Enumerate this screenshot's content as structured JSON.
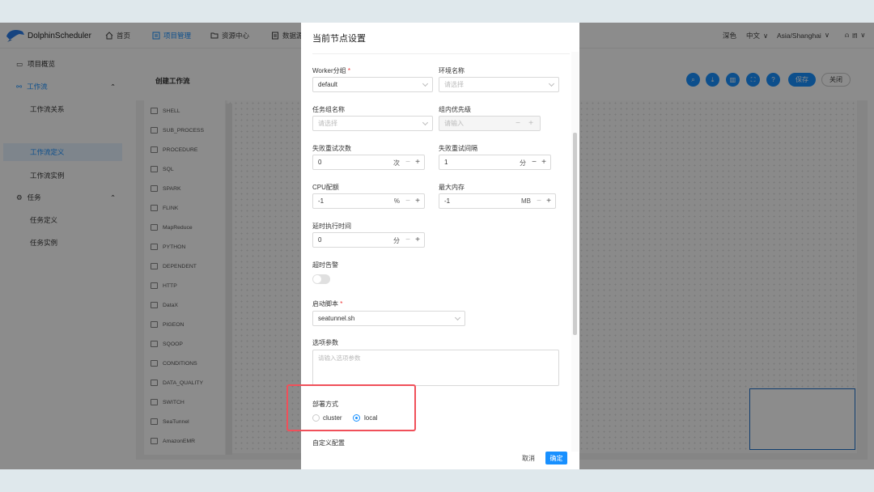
{
  "header": {
    "brand": "DolphinScheduler",
    "nav": [
      {
        "label": "首页",
        "icon": "home-icon"
      },
      {
        "label": "项目管理",
        "icon": "project-icon"
      },
      {
        "label": "资源中心",
        "icon": "folder-icon"
      },
      {
        "label": "数据源",
        "icon": "datasource-icon"
      }
    ],
    "right": {
      "theme": "深色",
      "lang": "中文",
      "timezone": "Asia/Shanghai",
      "user": "lfl"
    }
  },
  "sidebar": {
    "items": [
      {
        "label": "项目概览",
        "icon": "overview-icon"
      },
      {
        "label": "工作流",
        "icon": "workflow-icon"
      },
      {
        "label": "工作流关系"
      },
      {
        "label": "工作流定义"
      },
      {
        "label": "工作流实例"
      },
      {
        "label": "任务",
        "icon": "task-icon"
      },
      {
        "label": "任务定义"
      },
      {
        "label": "任务实例"
      }
    ]
  },
  "canvas": {
    "title": "创建工作流",
    "save": "保存",
    "close": "关闭",
    "icons": [
      "search-icon",
      "download-icon",
      "delete-icon",
      "fullscreen-icon",
      "settings-icon",
      "format-icon"
    ]
  },
  "tools": [
    "SHELL",
    "SUB_PROCESS",
    "PROCEDURE",
    "SQL",
    "SPARK",
    "FLINK",
    "MapReduce",
    "PYTHON",
    "DEPENDENT",
    "HTTP",
    "DataX",
    "PIGEON",
    "SQOOP",
    "CONDITIONS",
    "DATA_QUALITY",
    "SWITCH",
    "SeaTunnel",
    "AmazonEMR"
  ],
  "modal": {
    "title": "当前节点设置",
    "worker_group": {
      "label": "Worker分组",
      "required": "*",
      "value": "default"
    },
    "env_name": {
      "label": "环境名称",
      "placeholder": "请选择"
    },
    "task_group_name": {
      "label": "任务组名称",
      "placeholder": "请选择"
    },
    "group_priority": {
      "label": "组内优先级",
      "placeholder": "请输入"
    },
    "fail_retry_times": {
      "label": "失败重试次数",
      "value": "0",
      "unit": "次"
    },
    "fail_retry_interval": {
      "label": "失败重试间隔",
      "value": "1",
      "unit": "分"
    },
    "cpu_quota": {
      "label": "CPU配额",
      "value": "-1",
      "unit": "%"
    },
    "max_memory": {
      "label": "最大内存",
      "value": "-1",
      "unit": "MB"
    },
    "delay_time": {
      "label": "延时执行时间",
      "value": "0",
      "unit": "分"
    },
    "timeout_alarm": {
      "label": "超时告警",
      "on": false
    },
    "startup_script": {
      "label": "启动脚本",
      "required": "*",
      "value": "seatunnel.sh"
    },
    "option_params": {
      "label": "选项参数",
      "placeholder": "请输入选项参数"
    },
    "deploy_mode": {
      "label": "部署方式",
      "options": [
        "cluster",
        "local"
      ],
      "selected": "local"
    },
    "custom_config": {
      "label": "自定义配置"
    },
    "cancel": "取消",
    "confirm": "确定"
  },
  "colors": {
    "primary": "#1890ff",
    "highlight": "#f0505a"
  }
}
